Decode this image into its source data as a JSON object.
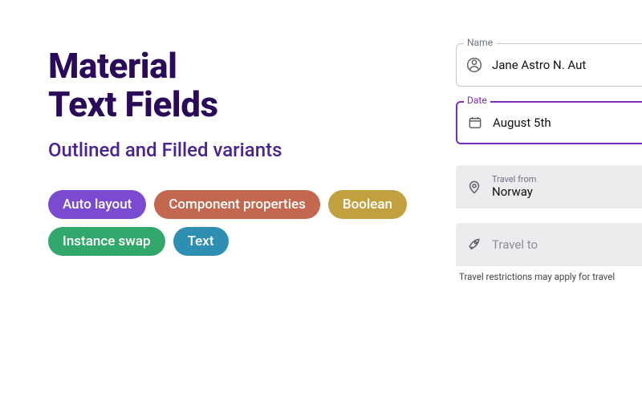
{
  "hero": {
    "title_line1": "Material",
    "title_line2": "Text Fields",
    "subtitle": "Outlined and Filled variants"
  },
  "chips": {
    "auto_layout": "Auto layout",
    "component_properties": "Component properties",
    "boolean": "Boolean",
    "instance_swap": "Instance swap",
    "text": "Text"
  },
  "fields": {
    "name": {
      "label": "Name",
      "value": "Jane Astro N. Aut"
    },
    "date": {
      "label": "Date",
      "value": "August 5th"
    },
    "travel_from": {
      "label": "Travel from",
      "value": "Norway"
    },
    "travel_to": {
      "label": "Travel to",
      "value": ""
    },
    "helper": "Travel restrictions may apply for travel"
  }
}
